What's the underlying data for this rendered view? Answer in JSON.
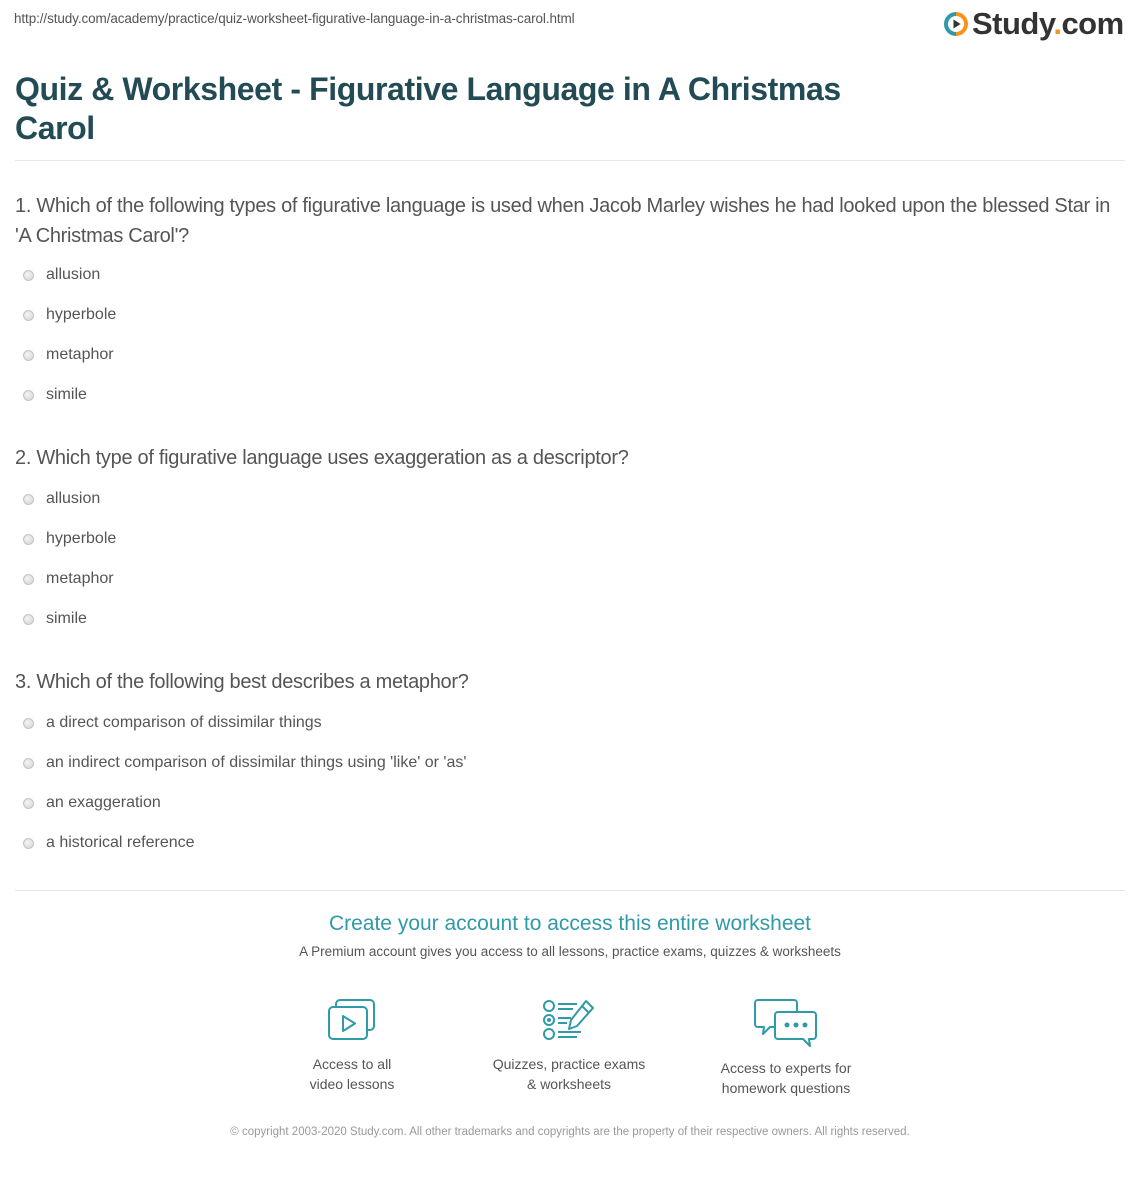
{
  "url": "http://study.com/academy/practice/quiz-worksheet-figurative-language-in-a-christmas-carol.html",
  "logo": {
    "text_main": "Study",
    "text_dot": ".",
    "text_tld": "com",
    "icon": "play-circle-icon"
  },
  "title": "Quiz & Worksheet - Figurative Language in A Christmas Carol",
  "questions": [
    {
      "text": "1. Which of the following types of figurative language is used when Jacob Marley wishes he had looked upon the blessed Star in 'A Christmas Carol'?",
      "options": [
        "allusion",
        "hyperbole",
        "metaphor",
        "simile"
      ]
    },
    {
      "text": "2. Which type of figurative language uses exaggeration as a descriptor?",
      "options": [
        "allusion",
        "hyperbole",
        "metaphor",
        "simile"
      ]
    },
    {
      "text": "3. Which of the following best describes a metaphor?",
      "options": [
        "a direct comparison of dissimilar things",
        "an indirect comparison of dissimilar things using 'like' or 'as'",
        "an exaggeration",
        "a historical reference"
      ]
    }
  ],
  "promo": {
    "title": "Create your account to access this entire worksheet",
    "subtitle": "A Premium account gives you access to all lessons, practice exams, quizzes & worksheets",
    "features": [
      {
        "icon": "video-lessons-icon",
        "line1": "Access to all",
        "line2": "video lessons"
      },
      {
        "icon": "quiz-checklist-icon",
        "line1": "Quizzes, practice exams",
        "line2": "& worksheets"
      },
      {
        "icon": "chat-bubbles-icon",
        "line1": "Access to experts for",
        "line2": "homework questions"
      }
    ]
  },
  "copyright": "© copyright 2003-2020 Study.com. All other trademarks and copyrights are the property of their respective owners. All rights reserved.",
  "colors": {
    "title": "#234b55",
    "accent": "#2f9aa8",
    "logo_dot": "#f7941d"
  }
}
